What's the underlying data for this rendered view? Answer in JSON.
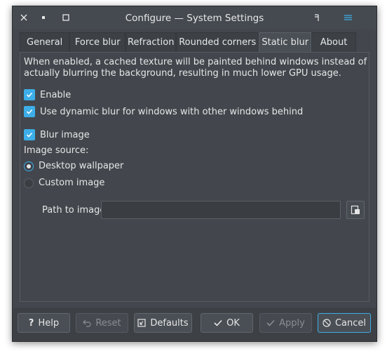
{
  "window": {
    "title": "Configure — System Settings"
  },
  "tabs": [
    {
      "label": "General"
    },
    {
      "label": "Force blur"
    },
    {
      "label": "Refraction"
    },
    {
      "label": "Rounded corners"
    },
    {
      "label": "Static blur",
      "active": true
    },
    {
      "label": "About"
    }
  ],
  "static_blur": {
    "description": "When enabled, a cached texture will be painted behind windows instead of actually blurring the background, resulting in much lower GPU usage.",
    "enable": {
      "label": "Enable",
      "checked": true
    },
    "dynamic_blur": {
      "label": "Use dynamic blur for windows with other windows behind",
      "checked": true
    },
    "blur_image": {
      "label": "Blur image",
      "checked": true
    },
    "image_source_label": "Image source:",
    "source_desktop": {
      "label": "Desktop wallpaper",
      "selected": true
    },
    "source_custom": {
      "label": "Custom image",
      "selected": false
    },
    "path_label": "Path to image",
    "path_value": ""
  },
  "buttons": {
    "help": "Help",
    "reset": "Reset",
    "defaults": "Defaults",
    "ok": "OK",
    "apply": "Apply",
    "cancel": "Cancel"
  },
  "icons": {
    "close": "close-icon",
    "keep_on_top": "pin-icon",
    "maximize": "maximize-icon",
    "app_menu": "app-menu-icon",
    "settings_menu": "menu-icon"
  },
  "colors": {
    "accent": "#3daee9",
    "background": "#43474d",
    "text": "#e6e6e6"
  }
}
